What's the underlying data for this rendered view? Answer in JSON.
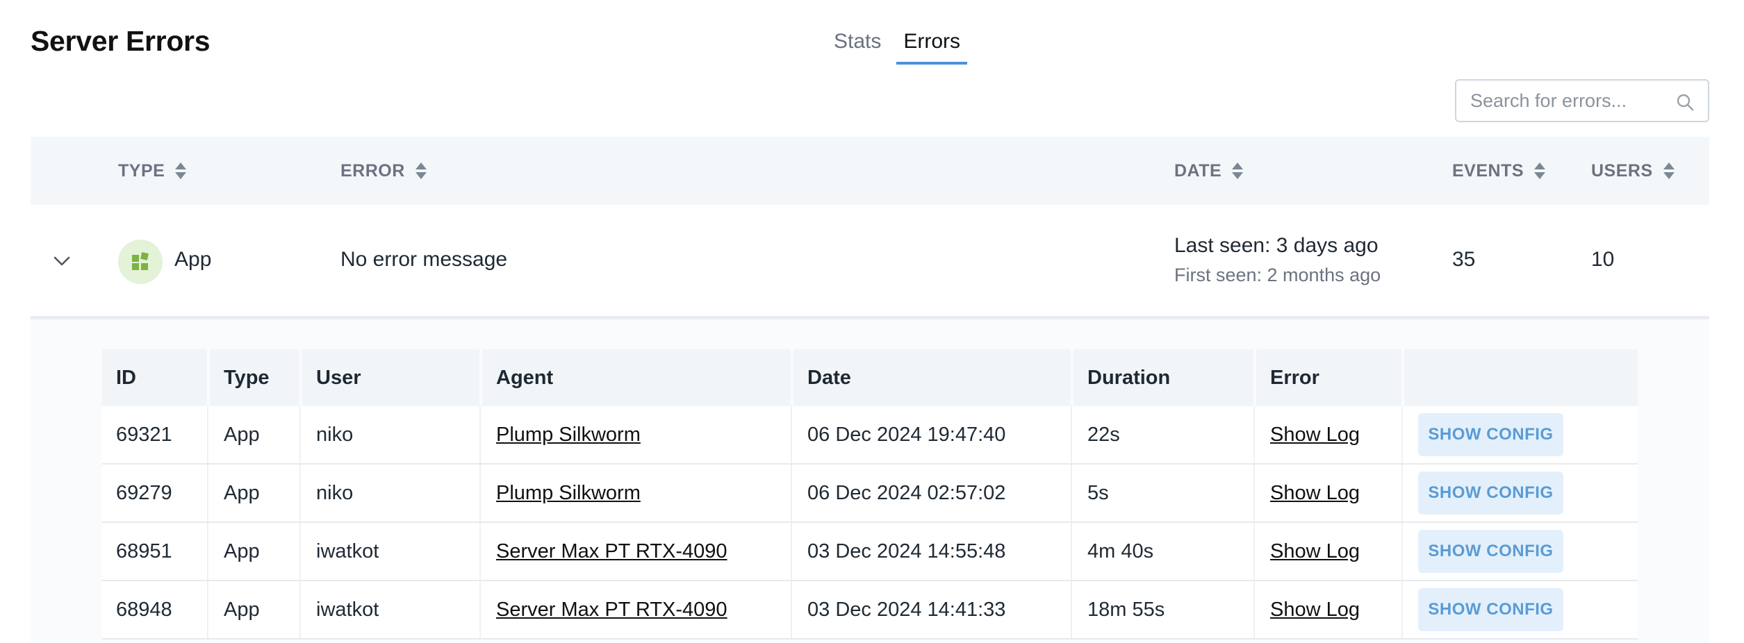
{
  "page": {
    "title": "Server Errors"
  },
  "tabs": [
    {
      "label": "Stats",
      "active": false
    },
    {
      "label": "Errors",
      "active": true
    }
  ],
  "search": {
    "placeholder": "Search for errors...",
    "value": ""
  },
  "table": {
    "columns": [
      {
        "label": "TYPE"
      },
      {
        "label": "ERROR"
      },
      {
        "label": "DATE"
      },
      {
        "label": "EVENTS"
      },
      {
        "label": "USERS"
      }
    ],
    "rows": [
      {
        "type": "App",
        "error": "No error message",
        "last_seen": "Last seen: 3 days ago",
        "first_seen": "First seen: 2 months ago",
        "events": "35",
        "users": "10",
        "expanded": true
      }
    ]
  },
  "details": {
    "columns": [
      "ID",
      "Type",
      "User",
      "Agent",
      "Date",
      "Duration",
      "Error",
      ""
    ],
    "rows": [
      {
        "id": "69321",
        "type": "App",
        "user": "niko",
        "agent": "Plump Silkworm",
        "date": "06 Dec 2024 19:47:40",
        "duration": "22s",
        "error": "Show Log",
        "action": "SHOW CONFIG"
      },
      {
        "id": "69279",
        "type": "App",
        "user": "niko",
        "agent": "Plump Silkworm",
        "date": "06 Dec 2024 02:57:02",
        "duration": "5s",
        "error": "Show Log",
        "action": "SHOW CONFIG"
      },
      {
        "id": "68951",
        "type": "App",
        "user": "iwatkot",
        "agent": "Server Max PT RTX-4090",
        "date": "03 Dec 2024 14:55:48",
        "duration": "4m 40s",
        "error": "Show Log",
        "action": "SHOW CONFIG"
      },
      {
        "id": "68948",
        "type": "App",
        "user": "iwatkot",
        "agent": "Server Max PT RTX-4090",
        "date": "03 Dec 2024 14:41:33",
        "duration": "18m 55s",
        "error": "Show Log",
        "action": "SHOW CONFIG"
      }
    ]
  },
  "colors": {
    "accent": "#4a90d9",
    "header_bg": "#f4f7fa",
    "badge_bg": "#e4f2d8",
    "app_icon": "#7cb342",
    "button_bg": "#e3f0fc",
    "button_text": "#5a9bd5"
  },
  "icons": {
    "search": "search-icon",
    "sort": "sort-icon",
    "expand": "chevron-down-icon",
    "app": "app-grid-icon"
  }
}
